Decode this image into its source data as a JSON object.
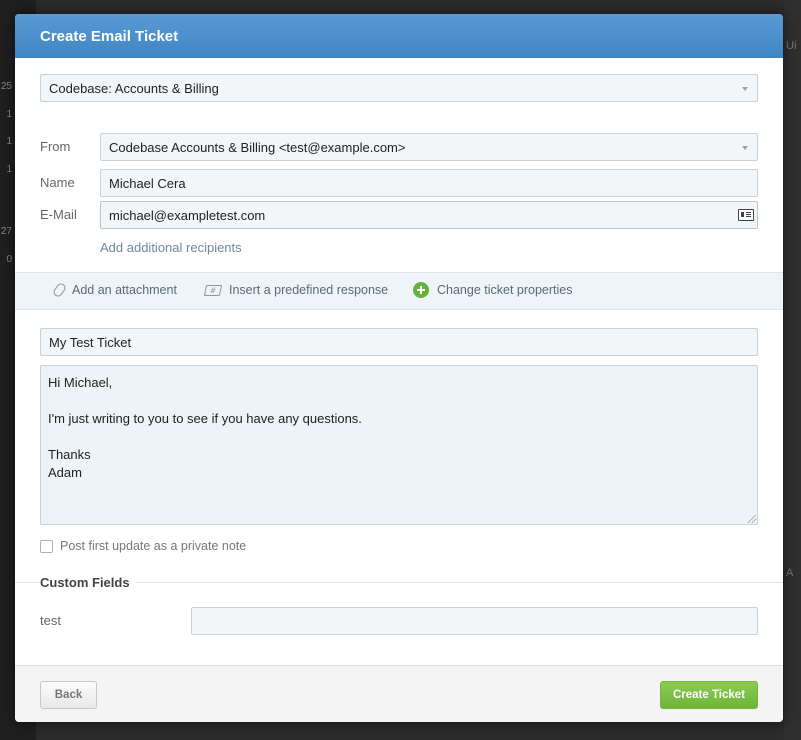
{
  "background": {
    "left_numbers": [
      "25",
      "1",
      "1",
      "1",
      "27",
      "0"
    ],
    "right_fragments": [
      "Ui",
      "A"
    ]
  },
  "modal": {
    "title": "Create Email Ticket",
    "mailbox_select": "Codebase: Accounts & Billing",
    "from": {
      "label": "From",
      "value": "Codebase Accounts & Billing <test@example.com>"
    },
    "name": {
      "label": "Name",
      "value": "Michael Cera"
    },
    "email": {
      "label": "E-Mail",
      "value": "michael@exampletest.com"
    },
    "add_recipients": "Add additional recipients",
    "toolbar": {
      "attachment": "Add an attachment",
      "predefined": "Insert a predefined response",
      "properties": "Change ticket properties"
    },
    "subject": "My Test Ticket",
    "body_lines": [
      "Hi Michael,",
      "",
      "I'm just writing to you to see if you have any questions.",
      "",
      "Thanks",
      "Adam"
    ],
    "private_note": {
      "label": "Post first update as a private note",
      "checked": false
    },
    "custom_fields": {
      "title": "Custom Fields",
      "fields": [
        {
          "label": "test",
          "value": ""
        }
      ]
    },
    "footer": {
      "back": "Back",
      "create": "Create Ticket"
    }
  },
  "colors": {
    "header": "#4a8fcb",
    "create_button": "#7cc046",
    "plus_icon": "#63b33c"
  }
}
